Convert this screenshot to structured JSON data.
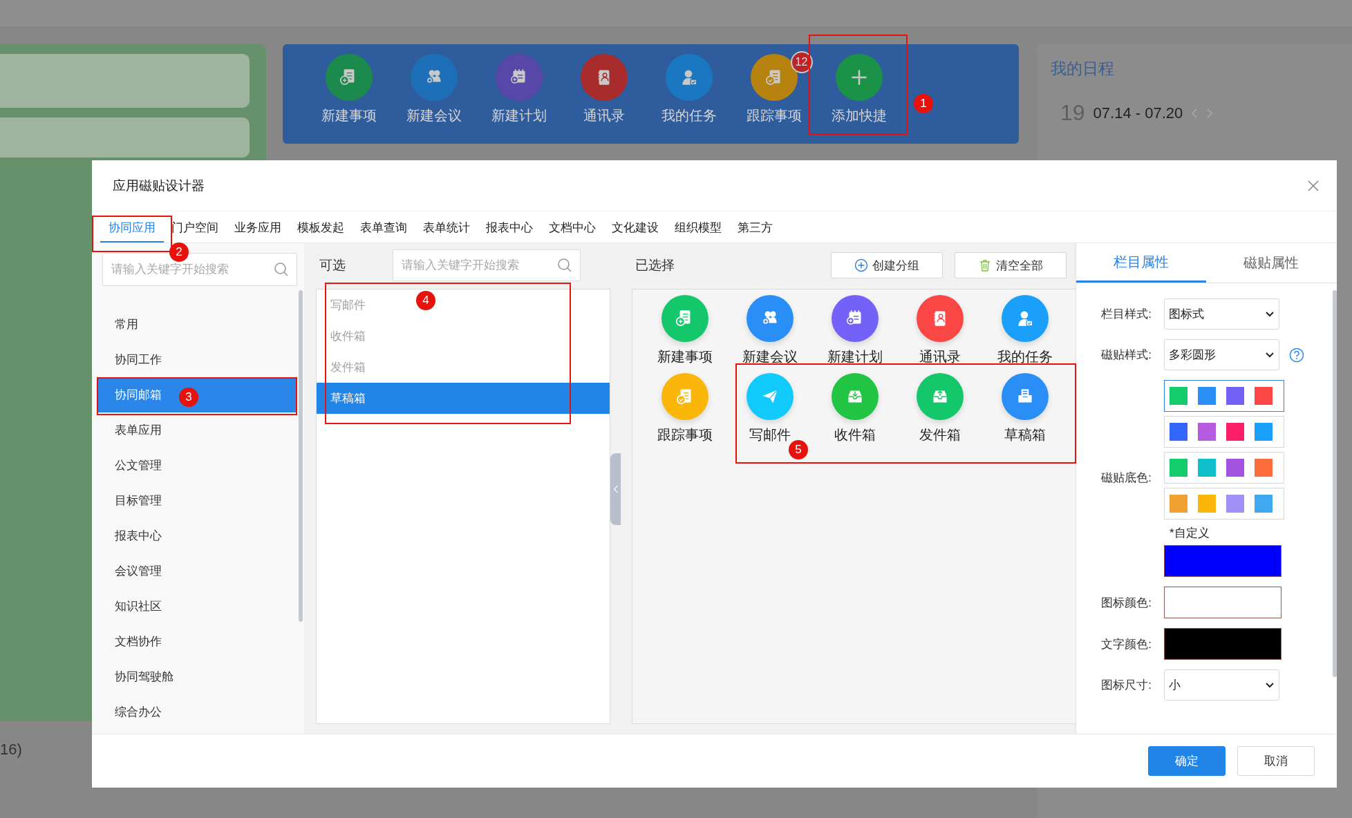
{
  "background": {
    "shortcuts": [
      {
        "label": "新建事项",
        "kind": "new-item",
        "color": "#1b8a4c"
      },
      {
        "label": "新建会议",
        "kind": "meeting",
        "color": "#1d6fb8"
      },
      {
        "label": "新建计划",
        "kind": "plan",
        "color": "#5747a8"
      },
      {
        "label": "通讯录",
        "kind": "contacts",
        "color": "#a82c2c"
      },
      {
        "label": "我的任务",
        "kind": "task",
        "color": "#1a78c2"
      },
      {
        "label": "跟踪事项",
        "kind": "tracking",
        "color": "#b8820f",
        "badge": "12"
      },
      {
        "label": "添加快捷",
        "kind": "add",
        "color": "#1a9248"
      }
    ],
    "schedule": {
      "title": "我的日程",
      "day": "19",
      "range": "07.14 - 07.20"
    },
    "side_note": "16)"
  },
  "dialog": {
    "title": "应用磁贴设计器",
    "tabs": [
      {
        "label": "协同应用",
        "selected": true
      },
      {
        "label": "门户空间",
        "selected": false
      },
      {
        "label": "业务应用",
        "selected": false
      },
      {
        "label": "模板发起",
        "selected": false
      },
      {
        "label": "表单查询",
        "selected": false
      },
      {
        "label": "表单统计",
        "selected": false
      },
      {
        "label": "报表中心",
        "selected": false
      },
      {
        "label": "文档中心",
        "selected": false
      },
      {
        "label": "文化建设",
        "selected": false
      },
      {
        "label": "组织模型",
        "selected": false
      },
      {
        "label": "第三方",
        "selected": false
      }
    ],
    "sidebar": {
      "placeholder": "请输入关键字开始搜索",
      "items": [
        {
          "label": "常用",
          "selected": false
        },
        {
          "label": "协同工作",
          "selected": false
        },
        {
          "label": "协同邮箱",
          "selected": true
        },
        {
          "label": "表单应用",
          "selected": false
        },
        {
          "label": "公文管理",
          "selected": false
        },
        {
          "label": "目标管理",
          "selected": false
        },
        {
          "label": "报表中心",
          "selected": false
        },
        {
          "label": "会议管理",
          "selected": false
        },
        {
          "label": "知识社区",
          "selected": false
        },
        {
          "label": "文档协作",
          "selected": false
        },
        {
          "label": "协同驾驶舱",
          "selected": false
        },
        {
          "label": "综合办公",
          "selected": false
        }
      ]
    },
    "available": {
      "label": "可选",
      "placeholder": "请输入关键字开始搜索",
      "items": [
        {
          "label": "写邮件",
          "disabled": true,
          "selected": false
        },
        {
          "label": "收件箱",
          "disabled": true,
          "selected": false
        },
        {
          "label": "发件箱",
          "disabled": true,
          "selected": false
        },
        {
          "label": "草稿箱",
          "disabled": false,
          "selected": true
        }
      ]
    },
    "chosen": {
      "label": "已选择",
      "buttons": [
        {
          "label": "创建分组",
          "kind": "add"
        },
        {
          "label": "清空全部",
          "kind": "clear"
        }
      ],
      "tiles": [
        {
          "label": "新建事项",
          "kind": "new-item",
          "color": "#13c76a"
        },
        {
          "label": "新建会议",
          "kind": "meeting",
          "color": "#2a8ef7"
        },
        {
          "label": "新建计划",
          "kind": "plan",
          "color": "#7461f7"
        },
        {
          "label": "通讯录",
          "kind": "contacts",
          "color": "#fb4646"
        },
        {
          "label": "我的任务",
          "kind": "task",
          "color": "#1a9ffb"
        },
        {
          "label": "跟踪事项",
          "kind": "tracking",
          "color": "#fbb60a"
        },
        {
          "label": "写邮件",
          "kind": "compose",
          "color": "#0fcafb"
        },
        {
          "label": "收件箱",
          "kind": "inbox",
          "color": "#22c443"
        },
        {
          "label": "发件箱",
          "kind": "outbox",
          "color": "#13c76a"
        },
        {
          "label": "草稿箱",
          "kind": "drafts",
          "color": "#2a8ef7"
        }
      ]
    },
    "properties": {
      "tabs": [
        {
          "label": "栏目属性",
          "selected": true
        },
        {
          "label": "磁贴属性",
          "selected": false
        }
      ],
      "column_style": {
        "label": "栏目样式:",
        "value": "图标式"
      },
      "tile_style": {
        "label": "磁贴样式:",
        "value": "多彩圆形"
      },
      "tile_color": {
        "label": "磁贴底色:",
        "rows": [
          {
            "selected": true,
            "swatches": [
              {
                "color": "#13cc6b"
              },
              {
                "color": "#2a8ef7"
              },
              {
                "color": "#7461f7"
              },
              {
                "color": "#fb4646"
              }
            ]
          },
          {
            "selected": false,
            "swatches": [
              {
                "color": "#3367fb"
              },
              {
                "color": "#b65be0"
              },
              {
                "color": "#fb1f6b"
              },
              {
                "color": "#1a9ffb"
              }
            ]
          },
          {
            "selected": false,
            "swatches": [
              {
                "color": "#13cc6b"
              },
              {
                "color": "#0fbfcc"
              },
              {
                "color": "#a352e0"
              },
              {
                "color": "#fb6b3c"
              }
            ]
          },
          {
            "selected": false,
            "swatches": [
              {
                "color": "#f0a030"
              },
              {
                "color": "#fbb60a"
              },
              {
                "color": "#a090f7"
              },
              {
                "color": "#40a8f0"
              }
            ]
          }
        ],
        "custom": {
          "label": "*自定义",
          "color": "#0000ff"
        }
      },
      "icon_color": {
        "label": "图标颜色:",
        "color": "#ffffff"
      },
      "text_color": {
        "label": "文字颜色:",
        "color": "#000000"
      },
      "icon_size": {
        "label": "图标尺寸:",
        "value": "小"
      }
    },
    "footer": [
      {
        "label": "确定",
        "kind": "primary"
      },
      {
        "label": "取消",
        "kind": "secondary"
      }
    ]
  },
  "annotations": [
    {
      "number": "1"
    },
    {
      "number": "2"
    },
    {
      "number": "3"
    },
    {
      "number": "4"
    },
    {
      "number": "5"
    }
  ]
}
